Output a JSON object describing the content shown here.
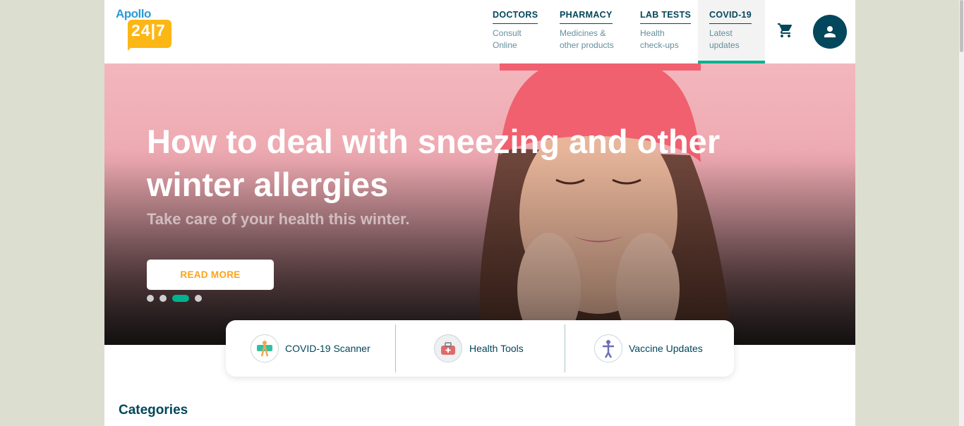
{
  "logo": {
    "brand": "Apollo",
    "number": "24|7"
  },
  "nav": [
    {
      "title": "DOCTORS",
      "sub": "Consult\nOnline"
    },
    {
      "title": "PHARMACY",
      "sub": "Medicines &\nother products"
    },
    {
      "title": "LAB TESTS",
      "sub": "Health\ncheck-ups"
    },
    {
      "title": "COVID-19",
      "sub": "Latest\nupdates",
      "active": true
    }
  ],
  "header_icons": [
    "cart-icon",
    "user-icon"
  ],
  "hero": {
    "title": "How to deal with sneezing and other winter allergies",
    "subtitle": "Take care of your health this winter.",
    "button": "READ MORE",
    "slides": 4,
    "active_slide": 3
  },
  "quick_links": [
    {
      "label": "COVID-19 Scanner",
      "icon": "covid-scanner-icon"
    },
    {
      "label": "Health Tools",
      "icon": "health-tools-icon"
    },
    {
      "label": "Vaccine Updates",
      "icon": "vaccine-icon"
    }
  ],
  "section_title": "Categories",
  "colors": {
    "brand": "#02475b",
    "accent": "#00b38e",
    "orange": "#fca317",
    "logo_yellow": "#fcb716"
  }
}
